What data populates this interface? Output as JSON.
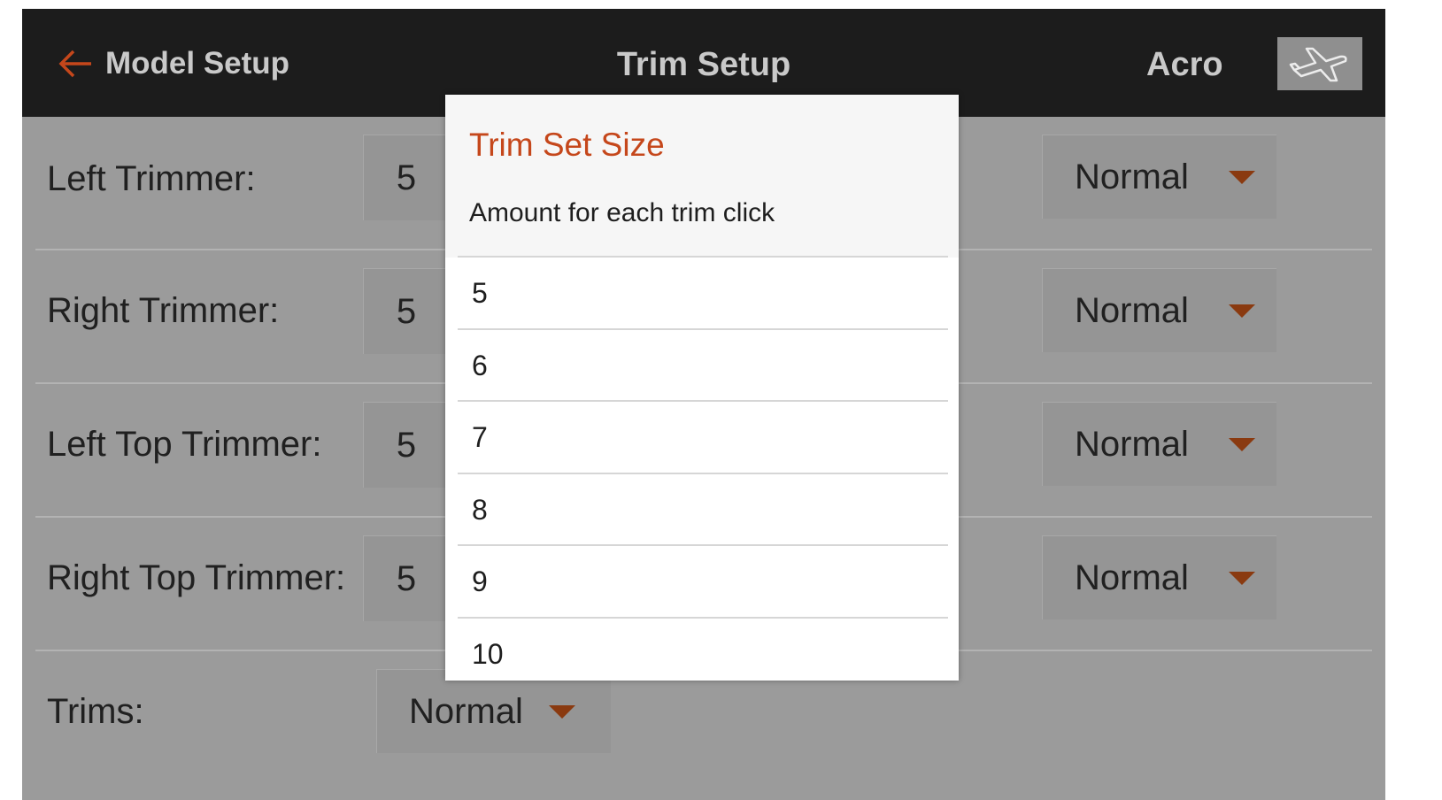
{
  "header": {
    "back_label": "Model Setup",
    "title": "Trim Setup",
    "mode": "Acro"
  },
  "rows": [
    {
      "label": "Left Trimmer:",
      "value": "5",
      "mode": "Normal"
    },
    {
      "label": "Right Trimmer:",
      "value": "5",
      "mode": "Normal"
    },
    {
      "label": "Left Top Trimmer:",
      "value": "5",
      "mode": "Normal"
    },
    {
      "label": "Right Top Trimmer:",
      "value": "5",
      "mode": "Normal"
    }
  ],
  "trims": {
    "label": "Trims:",
    "value": "Normal"
  },
  "dialog": {
    "title": "Trim Set Size",
    "subtitle": "Amount for each trim click",
    "options": [
      "5",
      "6",
      "7",
      "8",
      "9",
      "10"
    ]
  },
  "colors": {
    "accent": "#c5471b",
    "caret": "#8a3a10",
    "header_bg": "#1c1c1c",
    "screen_bg": "#9b9b9b"
  },
  "icons": [
    "arrow-left-icon",
    "airplane-icon",
    "dropdown-caret-icon"
  ]
}
